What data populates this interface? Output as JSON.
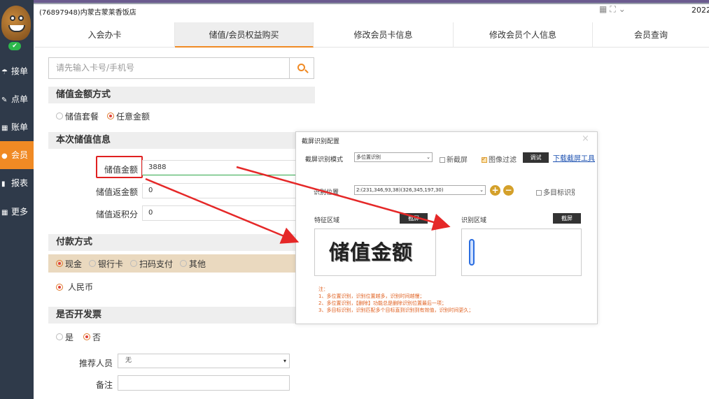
{
  "header": {
    "store_title": "(76897948)内蒙古蒙莱香饭店",
    "date_prefix": "2022-"
  },
  "sidebar": {
    "online_mark": "✔",
    "items": [
      {
        "icon": "hand-icon",
        "glyph": "☂",
        "label": "接单",
        "active": false
      },
      {
        "icon": "edit-icon",
        "glyph": "✎",
        "label": "点单",
        "active": false
      },
      {
        "icon": "grid-icon",
        "glyph": "▦",
        "label": "账单",
        "active": false
      },
      {
        "icon": "user-icon",
        "glyph": "●",
        "label": "会员",
        "active": true
      },
      {
        "icon": "bar-chart-icon",
        "glyph": "▮",
        "label": "报表",
        "active": false
      },
      {
        "icon": "apps-icon",
        "glyph": "▦",
        "label": "更多",
        "active": false
      }
    ]
  },
  "tabs": [
    {
      "label": "入会办卡",
      "active": false
    },
    {
      "label": "储值/会员权益购买",
      "active": true
    },
    {
      "label": "修改会员卡信息",
      "active": false
    },
    {
      "label": "修改会员个人信息",
      "active": false
    },
    {
      "label": "会员查询",
      "active": false
    }
  ],
  "search": {
    "placeholder": "请先输入卡号/手机号"
  },
  "recharge_method": {
    "title": "储值金额方式",
    "options": [
      {
        "label": "储值套餐",
        "selected": false
      },
      {
        "label": "任意金额",
        "selected": true
      }
    ]
  },
  "recharge_info": {
    "title": "本次储值信息",
    "amount_label": "储值金额",
    "amount_value": "3888",
    "bonus_amount_label": "储值返金额",
    "bonus_amount_value": "0",
    "bonus_points_label": "储值返积分",
    "bonus_points_value": "0"
  },
  "payment": {
    "title": "付款方式",
    "methods": [
      {
        "label": "现金",
        "selected": true
      },
      {
        "label": "银行卡",
        "selected": false
      },
      {
        "label": "扫码支付",
        "selected": false
      },
      {
        "label": "其他",
        "selected": false
      }
    ],
    "currency": {
      "label": "人民币",
      "selected": true
    }
  },
  "invoice": {
    "title": "是否开发票",
    "options": [
      {
        "label": "是",
        "selected": false
      },
      {
        "label": "否",
        "selected": true
      }
    ]
  },
  "referrer": {
    "label": "推荐人员",
    "value": "无"
  },
  "remark": {
    "label": "备注",
    "value": ""
  },
  "dialog": {
    "title": "截屏识别配置",
    "close": "×",
    "mode_label": "截屏识别模式",
    "mode_value": "多位置识别",
    "new_screenshot_label": "新截屏",
    "new_screenshot_checked": false,
    "image_filter_label": "图像过滤",
    "image_filter_checked": true,
    "debug_button": "调试",
    "download_link": "下载截屏工具",
    "position_label": "识别位置",
    "position_value": "2:(231,346,93,38)(326,345,197,30)",
    "add_button": "+",
    "remove_button": "−",
    "multi_target_label": "多目标识别",
    "multi_target_checked": false,
    "feature_area_label": "特征区域",
    "feature_screenshot_button": "截屏",
    "feature_text": "储值金额",
    "recognize_area_label": "识别区域",
    "recognize_screenshot_button": "截屏",
    "notes_title": "注：",
    "notes": [
      "1、多位置识别，识别位置越多，识别时间越慢；",
      "2、多位置识别，【删除】功能总是删除识别位置最后一项；",
      "3、多目标识别，识别匹配多个目标直到识别到有效值，识别时间更久；"
    ]
  },
  "colors": {
    "sidebar_bg": "#2f3a4a",
    "accent": "#f08a24",
    "highlight_box": "#e02020",
    "arrow": "#e52828"
  }
}
